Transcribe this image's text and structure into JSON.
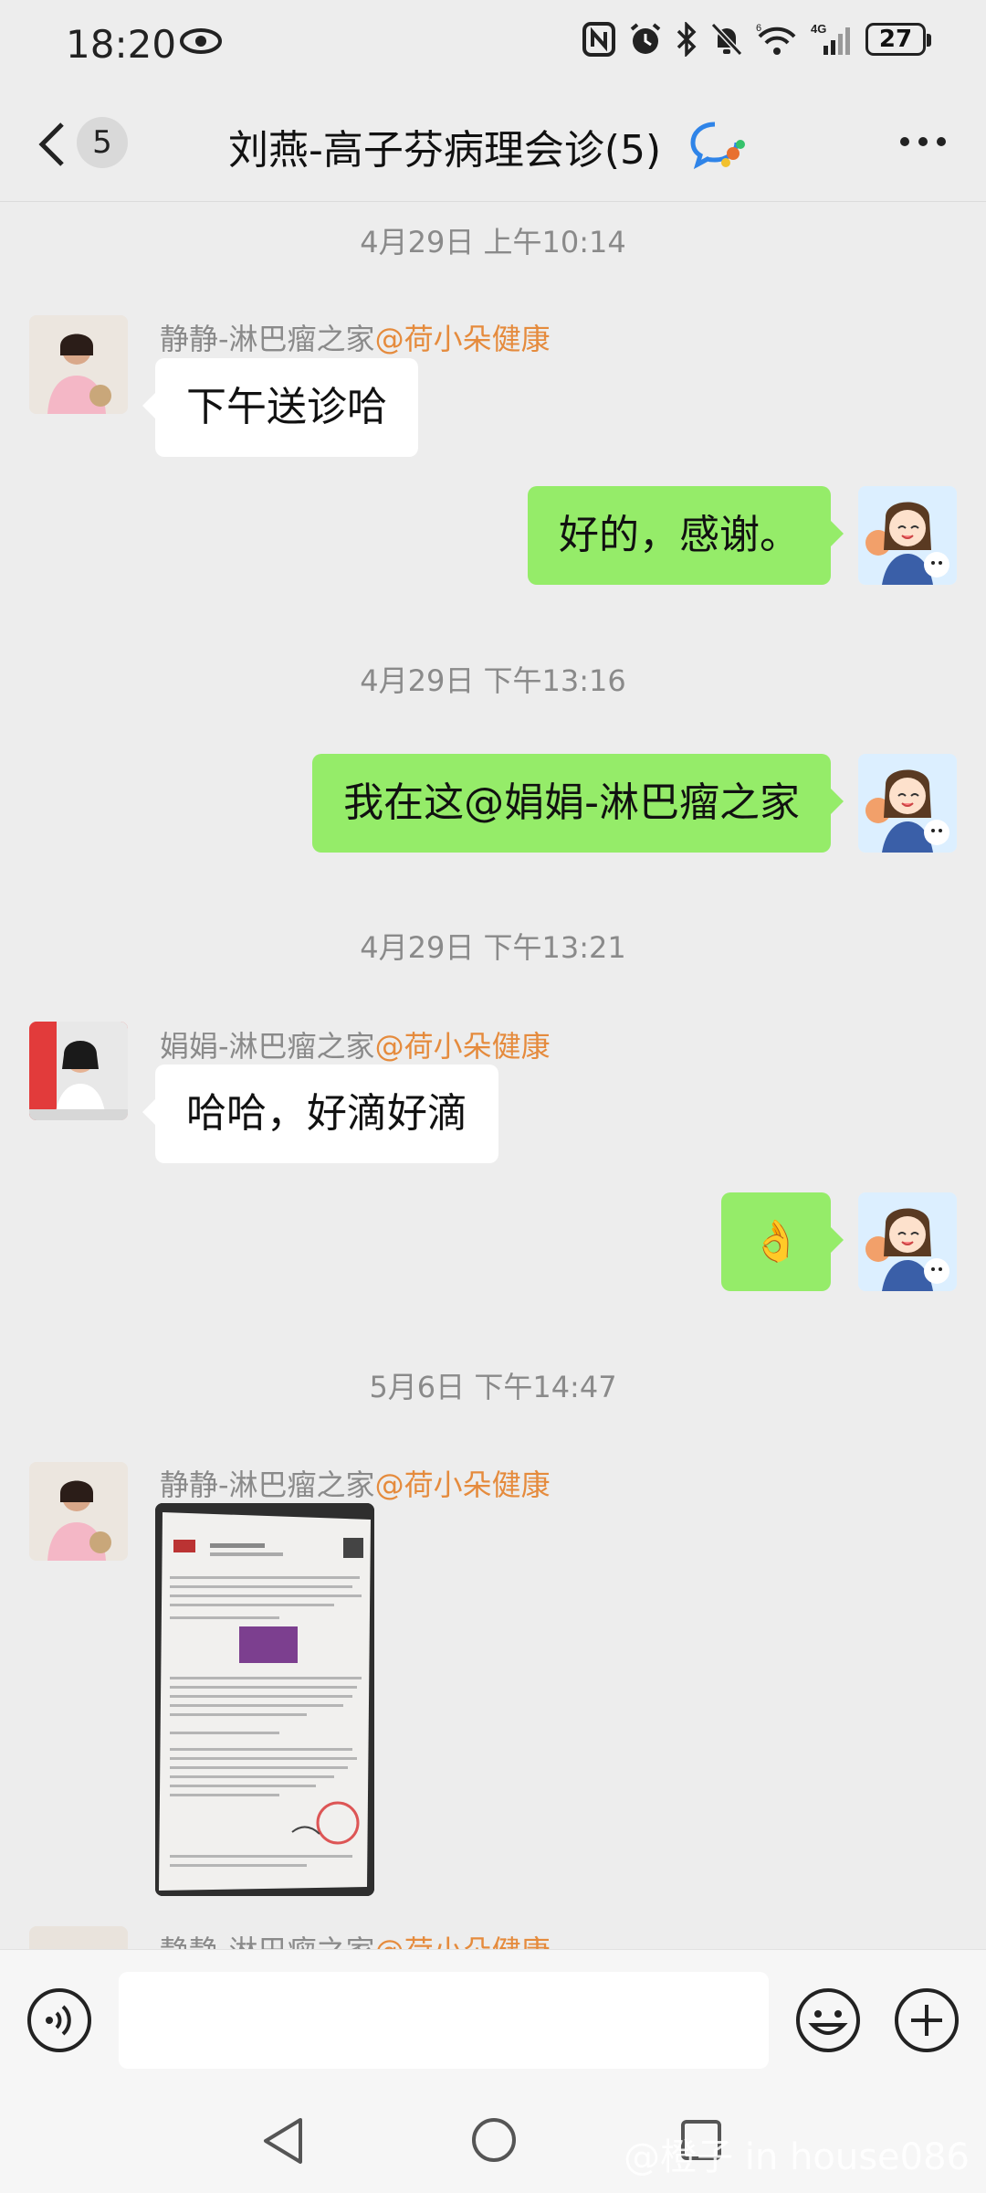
{
  "status_bar": {
    "time": "18:20",
    "battery": "27",
    "network": "4G"
  },
  "header": {
    "unread_count": "5",
    "title": "刘燕-高子芬病理会诊(5)"
  },
  "messages": [
    {
      "timestamp": "4月29日 上午10:14"
    },
    {
      "sender_name": "静静-淋巴瘤之家",
      "sender_tag": "@荷小朵健康",
      "text": "下午送诊哈"
    },
    {
      "text": "好的，感谢。"
    },
    {
      "timestamp": "4月29日 下午13:16"
    },
    {
      "text": "我在这@娟娟-淋巴瘤之家"
    },
    {
      "timestamp": "4月29日 下午13:21"
    },
    {
      "sender_name": "娟娟-淋巴瘤之家",
      "sender_tag": "@荷小朵健康",
      "text": "哈哈，好滴好滴"
    },
    {
      "text": "👌"
    },
    {
      "timestamp": "5月6日 下午14:47"
    },
    {
      "sender_name": "静静-淋巴瘤之家",
      "sender_tag": "@荷小朵健康"
    },
    {
      "sender_name": "静静-淋巴瘤之家",
      "sender_tag": "@荷小朵健康"
    }
  ],
  "input": {
    "placeholder": ""
  },
  "watermark": "@橙子 in house086",
  "colors": {
    "background": "#ededed",
    "outgoing_bubble": "#95ec69",
    "incoming_bubble": "#ffffff",
    "sender_tag": "#e58b3d"
  },
  "icons": [
    "eye-icon",
    "nfc-icon",
    "alarm-icon",
    "bluetooth-icon",
    "mute-icon",
    "wifi-icon",
    "signal-icon",
    "back-icon",
    "group-chat-icon",
    "more-icon",
    "voice-icon",
    "emoji-icon",
    "plus-icon"
  ]
}
